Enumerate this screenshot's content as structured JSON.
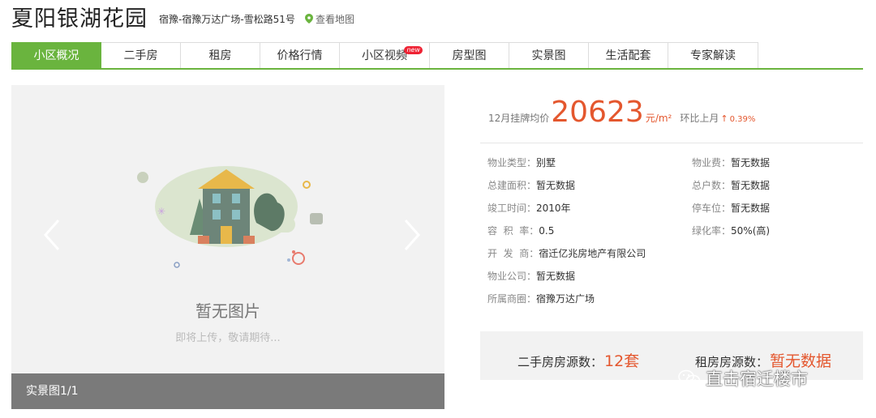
{
  "community": {
    "name": "夏阳银湖花园",
    "address": "宿豫-宿豫万达广场-雪松路51号",
    "map_link": "查看地图"
  },
  "tabs": [
    {
      "label": "小区概况",
      "active": true
    },
    {
      "label": "二手房"
    },
    {
      "label": "租房"
    },
    {
      "label": "价格行情"
    },
    {
      "label": "小区视频",
      "badge": "new"
    },
    {
      "label": "房型图"
    },
    {
      "label": "实景图"
    },
    {
      "label": "生活配套"
    },
    {
      "label": "专家解读"
    }
  ],
  "gallery": {
    "empty_text": "暂无图片",
    "empty_sub": "即将上传，敬请期待...",
    "caption": "实景图1/1"
  },
  "price": {
    "label": "12月挂牌均价",
    "value": "20623",
    "unit": "元/m²",
    "mom_label": "环比上月",
    "mom_arrow": "↑",
    "mom_value": "0.39%"
  },
  "info_left": [
    {
      "key": "物业类型：",
      "value": "别墅"
    },
    {
      "key": "总建面积：",
      "value": "暂无数据"
    },
    {
      "key": "竣工时间：",
      "value": "2010年"
    },
    {
      "key": "容  积  率：",
      "value": "0.5"
    },
    {
      "key": "开  发  商：",
      "value": "宿迁亿兆房地产有限公司"
    },
    {
      "key": "物业公司：",
      "value": "暂无数据"
    },
    {
      "key": "所属商圈：",
      "value": "宿豫万达广场"
    }
  ],
  "info_right": [
    {
      "key": "物业费：",
      "value": "暂无数据"
    },
    {
      "key": "总户数：",
      "value": "暂无数据"
    },
    {
      "key": "停车位：",
      "value": "暂无数据"
    },
    {
      "key": "绿化率：",
      "value": "50%(高)"
    }
  ],
  "counts": {
    "second_hand_label": "二手房房源数：",
    "second_hand_value": "12套",
    "rent_label": "租房房源数：",
    "rent_value": "暂无数据"
  },
  "watermark": "直击宿迁楼市",
  "colors": {
    "accent_green": "#6ab43e",
    "price_orange": "#e4572e"
  }
}
